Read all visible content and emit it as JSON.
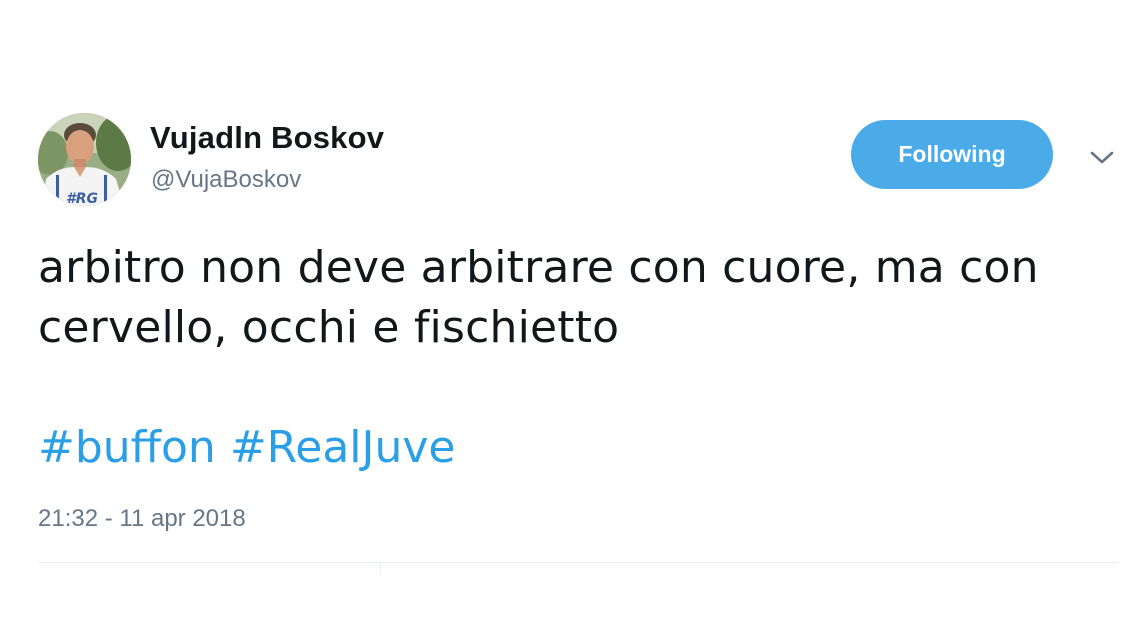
{
  "tweet": {
    "author": {
      "display_name": "Vujadln Boskov",
      "handle": "@VujaBoskov",
      "avatar_icon": "profile-photo-icon",
      "avatar_shirt_text": "#RG"
    },
    "follow_button": {
      "label": "Following",
      "color": "#4aabe8"
    },
    "menu_icon": "chevron-down-icon",
    "text_lines": [
      "arbitro non deve arbitrare con cuore, ma con",
      "cervello, occhi e fischietto"
    ],
    "hashtags": [
      "#buffon",
      "#RealJuve"
    ],
    "hashtag_color": "#2b9fe6",
    "timestamp": "21:32 - 11 apr 2018"
  }
}
